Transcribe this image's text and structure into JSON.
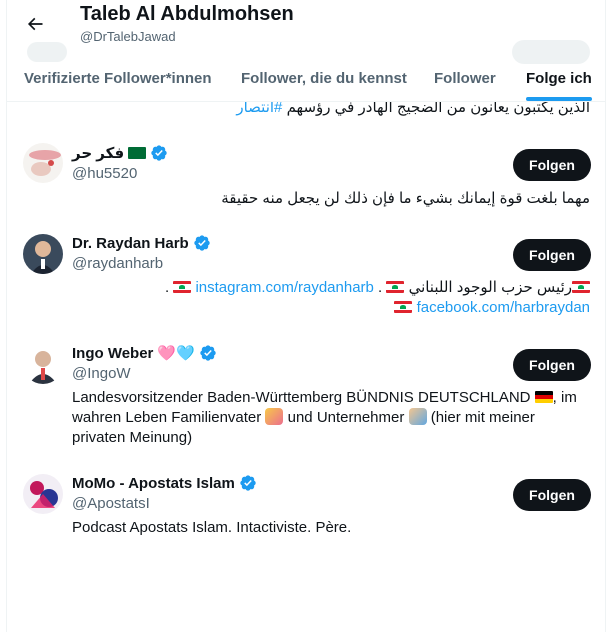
{
  "header": {
    "title": "Taleb Al Abdulmohsen",
    "handle": "@DrTalebJawad"
  },
  "tabs": [
    {
      "label": "Verifizierte Follower*innen",
      "active": false
    },
    {
      "label": "Follower, die du kennst",
      "active": false
    },
    {
      "label": "Follower",
      "active": false
    },
    {
      "label": "Folge ich",
      "active": true
    }
  ],
  "partial_row": {
    "bio_text": "الذين يكتبون يعانون من الضجيج الهادر في رؤسهم",
    "bio_hashtag": "#انتصار"
  },
  "users": [
    {
      "name": "فكر حر",
      "handle": "@hu5520",
      "follow_label": "Folgen",
      "bio": "مهما بلغت قوة إيمانك بشيء ما فإن ذلك لن يجعل منه حقيقة"
    },
    {
      "name": "Dr. Raydan Harb",
      "handle": "@raydanharb",
      "follow_label": "Folgen",
      "bio_text": "رئيس حزب الوجود اللبناني",
      "bio_link1": "instagram.com/raydanharb",
      "bio_link2": "facebook.com/harbraydan"
    },
    {
      "name": "Ingo Weber",
      "name_hearts": "🩷🩵",
      "handle": "@IngoW",
      "follow_label": "Folgen",
      "bio_part1": "Landesvorsitzender Baden-Württemberg BÜNDNIS DEUTSCHLAND",
      "bio_part2": ", im wahren Leben Familienvater",
      "bio_part3": "und Unternehmer",
      "bio_part4": "(hier mit meiner privaten Meinung)"
    },
    {
      "name": "MoMo - Apostats Islam",
      "handle": "@ApostatsI",
      "follow_label": "Folgen",
      "bio": "Podcast Apostats Islam. Intactiviste. Père."
    }
  ],
  "colors": {
    "accent": "#1d9bf0",
    "text": "#0f1419",
    "muted": "#536471",
    "button_bg": "#0f1419"
  }
}
